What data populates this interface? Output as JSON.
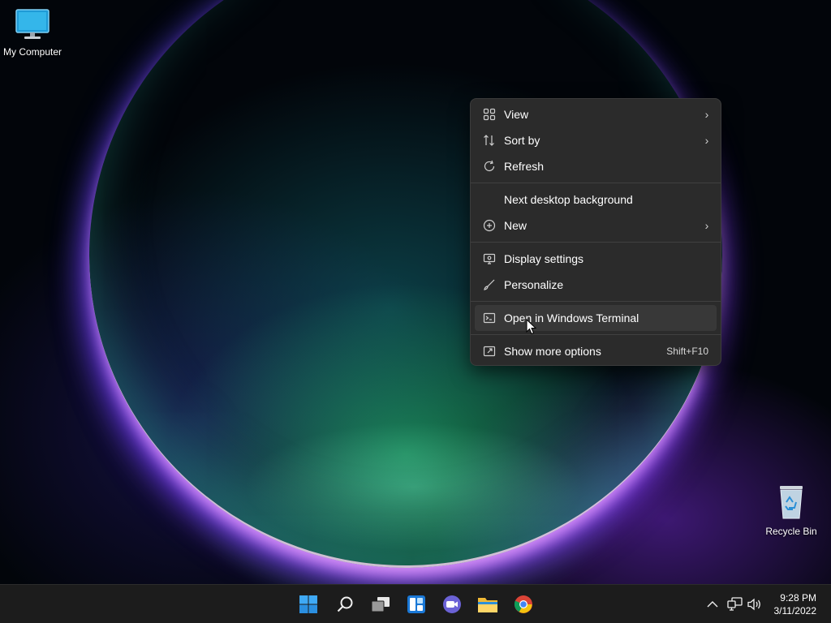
{
  "desktop": {
    "icons": [
      {
        "label": "My Computer",
        "icon": "monitor-icon"
      },
      {
        "label": "Recycle Bin",
        "icon": "recycle-bin-icon"
      }
    ]
  },
  "context_menu": {
    "items": [
      {
        "label": "View",
        "icon": "grid-icon",
        "submenu": true
      },
      {
        "label": "Sort by",
        "icon": "sort-icon",
        "submenu": true
      },
      {
        "label": "Refresh",
        "icon": "refresh-icon"
      },
      {
        "label": "Next desktop background",
        "icon": ""
      },
      {
        "label": "New",
        "icon": "plus-circle-icon",
        "submenu": true
      },
      {
        "label": "Display settings",
        "icon": "display-settings-icon"
      },
      {
        "label": "Personalize",
        "icon": "brush-icon"
      },
      {
        "label": "Open in Windows Terminal",
        "icon": "terminal-icon",
        "highlighted": true
      },
      {
        "label": "Show more options",
        "icon": "share-icon",
        "shortcut": "Shift+F10"
      }
    ]
  },
  "taskbar": {
    "apps": [
      "start-icon",
      "search-icon",
      "task-view-icon",
      "widgets-icon",
      "chat-icon",
      "file-explorer-icon",
      "chrome-icon"
    ],
    "tray": [
      "chevron-up-icon",
      "network-icon",
      "volume-icon"
    ],
    "clock": {
      "time": "9:28 PM",
      "date": "3/11/2022"
    }
  },
  "colors": {
    "menu_bg": "#2b2b2b",
    "menu_hover": "#383838",
    "taskbar_bg": "#1c1c1c",
    "accent": "#4cc2ff"
  }
}
